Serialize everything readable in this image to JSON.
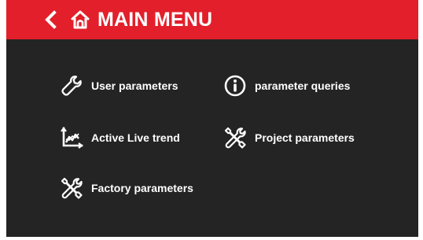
{
  "header": {
    "title": "MAIN MENU",
    "back_icon": "chevron-left-icon",
    "home_icon": "home-icon"
  },
  "menu": {
    "items": [
      {
        "label": "User parameters",
        "icon": "wrench-icon"
      },
      {
        "label": "parameter queries",
        "icon": "info-icon"
      },
      {
        "label": "Active Live trend",
        "icon": "trend-chart-icon"
      },
      {
        "label": "Project parameters",
        "icon": "tools-icon"
      },
      {
        "label": "Factory parameters",
        "icon": "tools-icon"
      }
    ]
  },
  "colors": {
    "header_bg": "#e21f2a",
    "body_bg": "#242424",
    "text": "#ffffff"
  }
}
